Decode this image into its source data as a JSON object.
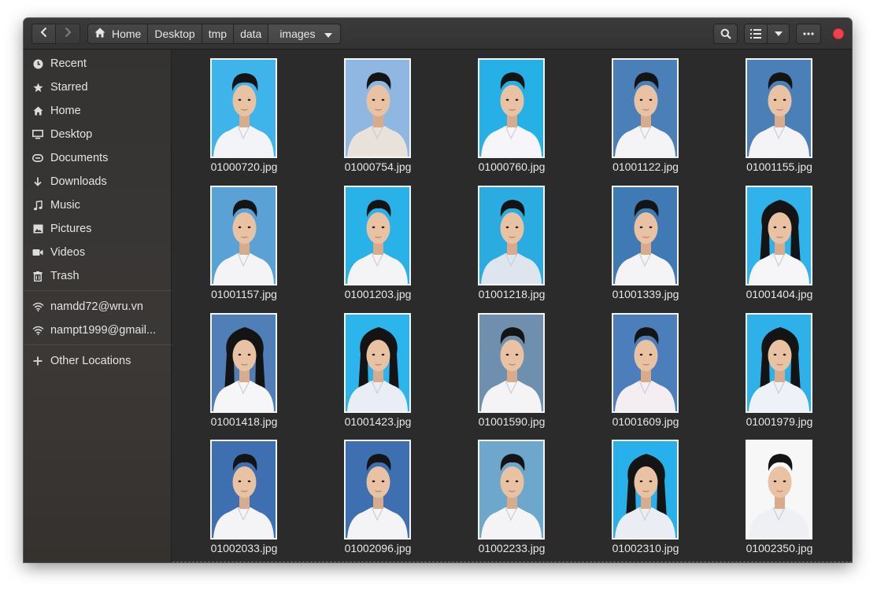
{
  "header": {
    "back_icon": "go-back-icon",
    "forward_icon": "go-forward-icon",
    "breadcrumbs": [
      "Home",
      "Desktop",
      "tmp",
      "data",
      "images"
    ],
    "search_icon": "search-icon",
    "view_icon": "list-view-icon",
    "menu_icon": "more-options-icon",
    "close_color": "#f0414c"
  },
  "sidebar": {
    "places": [
      {
        "label": "Recent",
        "icon": "clock-icon"
      },
      {
        "label": "Starred",
        "icon": "star-icon"
      },
      {
        "label": "Home",
        "icon": "home-icon"
      },
      {
        "label": "Desktop",
        "icon": "desktop-icon"
      },
      {
        "label": "Documents",
        "icon": "documents-icon"
      },
      {
        "label": "Downloads",
        "icon": "downloads-icon"
      },
      {
        "label": "Music",
        "icon": "music-icon"
      },
      {
        "label": "Pictures",
        "icon": "pictures-icon"
      },
      {
        "label": "Videos",
        "icon": "videos-icon"
      },
      {
        "label": "Trash",
        "icon": "trash-icon"
      }
    ],
    "network": [
      {
        "label": "namdd72@wru.vn",
        "icon": "network-share-icon"
      },
      {
        "label": "nampt1999@gmail...",
        "icon": "network-share-icon"
      }
    ],
    "other": {
      "label": "Other Locations",
      "icon": "plus-icon"
    }
  },
  "files": [
    {
      "name": "01000720.jpg",
      "bg": "#3fb4ea",
      "hair": "long-m",
      "shirt": "#f2f4f8"
    },
    {
      "name": "01000754.jpg",
      "bg": "#8fb7e2",
      "hair": "short",
      "shirt": "#e8e2da"
    },
    {
      "name": "01000760.jpg",
      "bg": "#25b0e6",
      "hair": "short",
      "shirt": "#f6f6fa"
    },
    {
      "name": "01001122.jpg",
      "bg": "#4a7fb8",
      "hair": "short",
      "shirt": "#f4f4f6"
    },
    {
      "name": "01001155.jpg",
      "bg": "#4a7fb8",
      "hair": "short",
      "shirt": "#f4f4f6"
    },
    {
      "name": "01001157.jpg",
      "bg": "#5aa2d6",
      "hair": "short",
      "shirt": "#f4f4f6"
    },
    {
      "name": "01001203.jpg",
      "bg": "#28b2e8",
      "hair": "short",
      "shirt": "#f4f4f6"
    },
    {
      "name": "01001218.jpg",
      "bg": "#2aace0",
      "hair": "short",
      "shirt": "#dfe5ef"
    },
    {
      "name": "01001339.jpg",
      "bg": "#3f7ab5",
      "hair": "short",
      "shirt": "#f4f4f6"
    },
    {
      "name": "01001404.jpg",
      "bg": "#2fb3ea",
      "hair": "long-f",
      "shirt": "#f6f6f8"
    },
    {
      "name": "01001418.jpg",
      "bg": "#4f7fb6",
      "hair": "long-f",
      "shirt": "#f6f6f8"
    },
    {
      "name": "01001423.jpg",
      "bg": "#2cb4ec",
      "hair": "long-f",
      "shirt": "#e9eef6"
    },
    {
      "name": "01001590.jpg",
      "bg": "#6e8fae",
      "hair": "short",
      "shirt": "#f4f4f6"
    },
    {
      "name": "01001609.jpg",
      "bg": "#4b7ebb",
      "hair": "short",
      "shirt": "#f4eef2"
    },
    {
      "name": "01001979.jpg",
      "bg": "#2eb0e8",
      "hair": "long-f",
      "shirt": "#eef2f8"
    },
    {
      "name": "01002033.jpg",
      "bg": "#3d6fb1",
      "hair": "short",
      "shirt": "#f4f4f6"
    },
    {
      "name": "01002096.jpg",
      "bg": "#3d6fb1",
      "hair": "short",
      "shirt": "#f4f4f6"
    },
    {
      "name": "01002233.jpg",
      "bg": "#6ea7cc",
      "hair": "short",
      "shirt": "#f4f4f6"
    },
    {
      "name": "01002310.jpg",
      "bg": "#28b0ea",
      "hair": "long-f",
      "shirt": "#eaeef4"
    },
    {
      "name": "01002350.jpg",
      "bg": "#f7f7f7",
      "hair": "short",
      "shirt": "#eef0f4"
    }
  ]
}
